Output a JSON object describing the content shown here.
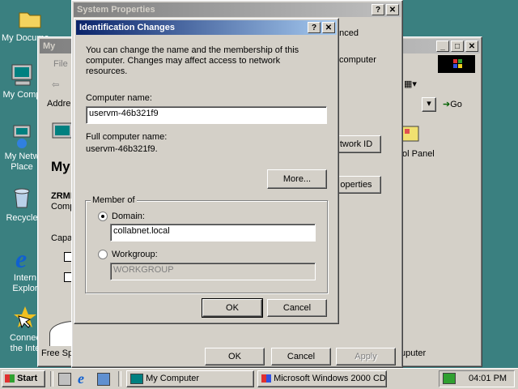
{
  "desktop": {
    "icons": [
      {
        "label1": "My Docume",
        "label2": ""
      },
      {
        "label1": "My Comp",
        "label2": ""
      },
      {
        "label1": "My Netw",
        "label2": "Place"
      },
      {
        "label1": "Recycle",
        "label2": ""
      },
      {
        "label1": "Intern",
        "label2": "Explor"
      },
      {
        "label1": "Connec",
        "label2": "the Inte"
      }
    ]
  },
  "mycomputer": {
    "title": "My",
    "menu_file": "File",
    "address_label": "Addre",
    "go_label": "Go",
    "heading": "My",
    "section_line1": "ZRMI",
    "section_line2": "Comp",
    "capacity_label": "Capac",
    "item_label": "ol Panel",
    "status_free": "Free Spa",
    "status_computer": "uputer"
  },
  "sysprops": {
    "title": "System Properties",
    "tab_advanced": "anced",
    "computer_text": "computer",
    "network_id_button": "twork ID",
    "properties_button": "operties",
    "ok": "OK",
    "cancel": "Cancel",
    "apply": "Apply"
  },
  "dialog": {
    "title": "Identification Changes",
    "description": "You can change the name and the membership of this computer. Changes may affect access to network resources.",
    "computer_name_label": "Computer name:",
    "computer_name_value": "uservm-46b321f9",
    "full_name_label": "Full computer name:",
    "full_name_value": "uservm-46b321f9.",
    "more_button": "More...",
    "member_of": "Member of",
    "domain_label": "Domain:",
    "domain_value": "collabnet.local",
    "workgroup_label": "Workgroup:",
    "workgroup_value": "WORKGROUP",
    "ok": "OK",
    "cancel": "Cancel"
  },
  "taskbar": {
    "start": "Start",
    "task1": "My Computer",
    "task2": "Microsoft Windows 2000 CD",
    "clock": "04:01 PM"
  }
}
